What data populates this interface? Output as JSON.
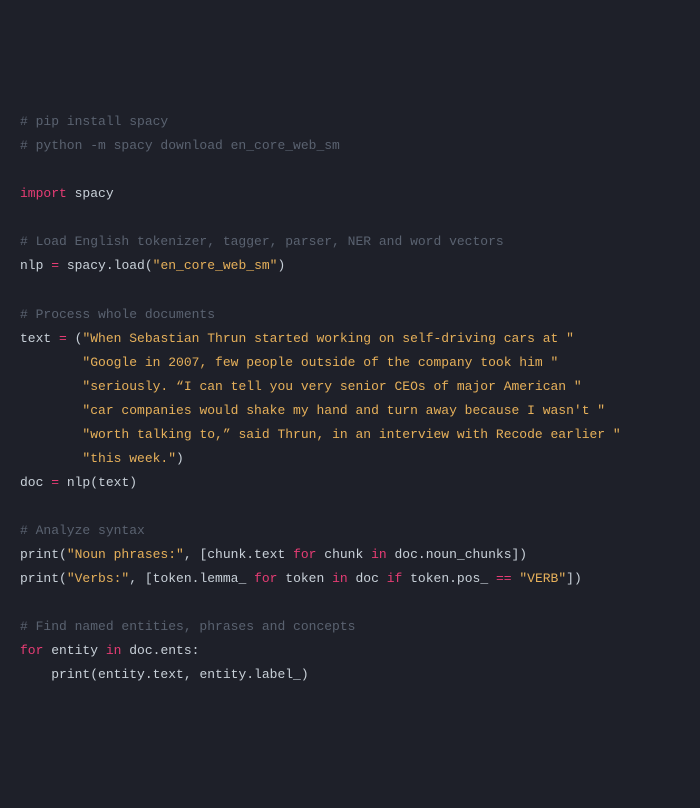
{
  "code": {
    "c1": "# pip install spacy",
    "c2": "# python -m spacy download en_core_web_sm",
    "kw_import": "import",
    "mod_spacy": " spacy",
    "c3": "# Load English tokenizer, tagger, parser, NER and word vectors",
    "nlp": "nlp ",
    "eq": "=",
    "spacy_load": " spacy.load(",
    "str_model": "\"en_core_web_sm\"",
    "close_p": ")",
    "c4": "# Process whole documents",
    "text_ident": "text ",
    "open_p": " (",
    "s1": "\"When Sebastian Thrun started working on self-driving cars at \"",
    "s2": "\"Google in 2007, few people outside of the company took him \"",
    "s3": "\"seriously. “I can tell you very senior CEOs of major American \"",
    "s4": "\"car companies would shake my hand and turn away because I wasn't \"",
    "s5": "\"worth talking to,” said Thrun, in an interview with Recode earlier \"",
    "s6": "\"this week.\"",
    "doc_ident": "doc ",
    "nlp_call": " nlp(text)",
    "c5": "# Analyze syntax",
    "print1a": "print(",
    "str_np": "\"Noun phrases:\"",
    "comma_sp": ", [chunk.text ",
    "kw_for": "for",
    "chunk_in": " chunk ",
    "kw_in": "in",
    "noun_chunks": " doc.noun_chunks])",
    "print2a": "print(",
    "str_verbs": "\"Verbs:\"",
    "comma_sp2": ", [token.lemma_ ",
    "token_in": " token ",
    "doc_in": " doc ",
    "kw_if": "if",
    "tok_pos": " token.pos_ ",
    "eqeq": "==",
    "str_verb": " \"VERB\"",
    "close_br": "])",
    "c6": "# Find named entities, phrases and concepts",
    "entity_in": " entity ",
    "doc_ents": " doc.ents:",
    "indent": "    ",
    "print3": "print(entity.text, entity.label_)"
  }
}
